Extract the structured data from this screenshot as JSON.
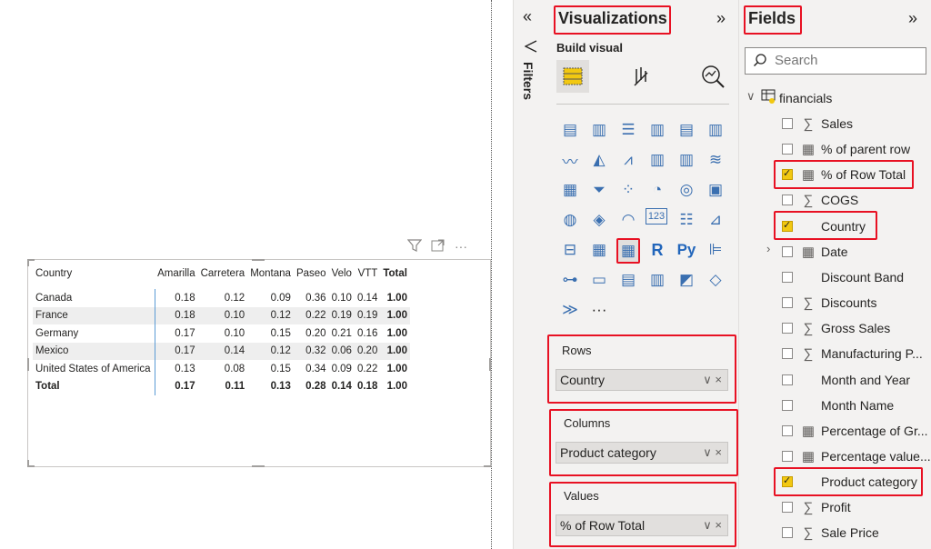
{
  "visual": {
    "header_icons": [
      "filter-icon",
      "focus-mode-icon",
      "more-options-icon"
    ],
    "more_label": "···",
    "matrix": {
      "columns": [
        "Country",
        "Amarilla",
        "Carretera",
        "Montana",
        "Paseo",
        "Velo",
        "VTT",
        "Total"
      ],
      "rows": [
        [
          "Canada",
          "0.18",
          "0.12",
          "0.09",
          "0.36",
          "0.10",
          "0.14",
          "1.00"
        ],
        [
          "France",
          "0.18",
          "0.10",
          "0.12",
          "0.22",
          "0.19",
          "0.19",
          "1.00"
        ],
        [
          "Germany",
          "0.17",
          "0.10",
          "0.15",
          "0.20",
          "0.21",
          "0.16",
          "1.00"
        ],
        [
          "Mexico",
          "0.17",
          "0.14",
          "0.12",
          "0.32",
          "0.06",
          "0.20",
          "1.00"
        ],
        [
          "United States of America",
          "0.13",
          "0.08",
          "0.15",
          "0.34",
          "0.09",
          "0.22",
          "1.00"
        ]
      ],
      "total_row": [
        "Total",
        "0.17",
        "0.11",
        "0.13",
        "0.28",
        "0.14",
        "0.18",
        "1.00"
      ]
    }
  },
  "filters": {
    "label": "Filters",
    "collapse": "«"
  },
  "visualizations": {
    "title": "Visualizations",
    "expand": "»",
    "build_visual": "Build visual",
    "more": "···",
    "wells": {
      "rows": {
        "title": "Rows",
        "value": "Country"
      },
      "columns": {
        "title": "Columns",
        "value": "Product category"
      },
      "values": {
        "title": "Values",
        "value": "% of Row Total"
      }
    },
    "pill_controls": "∨ ×"
  },
  "fields": {
    "title": "Fields",
    "expand": "»",
    "search_placeholder": "Search",
    "table_name": "financials",
    "items": [
      {
        "name": "Sales",
        "glyph": "∑",
        "checked": false
      },
      {
        "name": "% of parent row",
        "glyph": "▦",
        "checked": false
      },
      {
        "name": "% of Row Total",
        "glyph": "▦",
        "checked": true
      },
      {
        "name": "COGS",
        "glyph": "∑",
        "checked": false
      },
      {
        "name": "Country",
        "glyph": "",
        "checked": true
      },
      {
        "name": "Date",
        "glyph": "▦",
        "checked": false
      },
      {
        "name": "Discount Band",
        "glyph": "",
        "checked": false
      },
      {
        "name": "Discounts",
        "glyph": "∑",
        "checked": false
      },
      {
        "name": "Gross Sales",
        "glyph": "∑",
        "checked": false
      },
      {
        "name": "Manufacturing P...",
        "glyph": "∑",
        "checked": false
      },
      {
        "name": "Month and Year",
        "glyph": "",
        "checked": false
      },
      {
        "name": "Month Name",
        "glyph": "",
        "checked": false
      },
      {
        "name": "Percentage of Gr...",
        "glyph": "▦",
        "checked": false
      },
      {
        "name": "Percentage value...",
        "glyph": "▦",
        "checked": false
      },
      {
        "name": "Product category",
        "glyph": "",
        "checked": true
      },
      {
        "name": "Profit",
        "glyph": "∑",
        "checked": false
      },
      {
        "name": "Sale Price",
        "glyph": "∑",
        "checked": false
      }
    ]
  },
  "colors": {
    "highlight": "#e81123",
    "checked": "#f2c811",
    "pane": "#f3f2f1",
    "rowshade": "#eeeeee"
  }
}
